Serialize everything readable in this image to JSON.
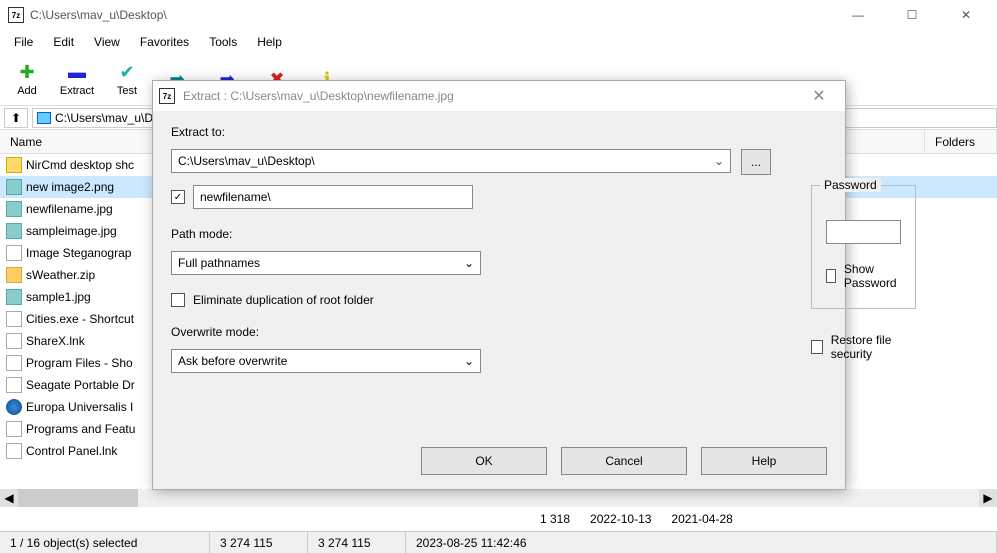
{
  "window": {
    "title": "C:\\Users\\mav_u\\Desktop\\",
    "appicon": "7z"
  },
  "menu": [
    "File",
    "Edit",
    "View",
    "Favorites",
    "Tools",
    "Help"
  ],
  "toolbar": {
    "add": "Add",
    "extract": "Extract",
    "test": "Test"
  },
  "address": "C:\\Users\\mav_u\\Desktop\\",
  "headers": {
    "name": "Name",
    "folders": "Folders"
  },
  "files": [
    {
      "name": "NirCmd desktop shc",
      "icon": "folder"
    },
    {
      "name": "new image2.png",
      "icon": "img",
      "sel": true
    },
    {
      "name": "newfilename.jpg",
      "icon": "img"
    },
    {
      "name": "sampleimage.jpg",
      "icon": "img"
    },
    {
      "name": "Image Steganograp",
      "icon": "lnk"
    },
    {
      "name": "sWeather.zip",
      "icon": "zip"
    },
    {
      "name": "sample1.jpg",
      "icon": "img"
    },
    {
      "name": "Cities.exe - Shortcut",
      "icon": "lnk"
    },
    {
      "name": "ShareX.lnk",
      "icon": "lnk"
    },
    {
      "name": "Program Files - Sho",
      "icon": "lnk"
    },
    {
      "name": "Seagate Portable Dr",
      "icon": "lnk"
    },
    {
      "name": "Europa Universalis I",
      "icon": "globe"
    },
    {
      "name": "Programs and Featu",
      "icon": "lnk"
    },
    {
      "name": "Control Panel.lnk",
      "icon": "lnk"
    }
  ],
  "detail": {
    "size": "1 318",
    "date1": "2022-10-13",
    "date2": "2021-04-28"
  },
  "status": {
    "sel": "1 / 16 object(s) selected",
    "s1": "3 274 115",
    "s2": "3 274 115",
    "ts": "2023-08-25 11:42:46"
  },
  "dialog": {
    "title": "Extract : C:\\Users\\mav_u\\Desktop\\newfilename.jpg",
    "extract_to_lbl": "Extract to:",
    "extract_to_val": "C:\\Users\\mav_u\\Desktop\\",
    "browse": "...",
    "subfolder_checked": true,
    "subfolder_val": "newfilename\\",
    "path_mode_lbl": "Path mode:",
    "path_mode_val": "Full pathnames",
    "elim_lbl": "Eliminate duplication of root folder",
    "overwrite_lbl": "Overwrite mode:",
    "overwrite_val": "Ask before overwrite",
    "password_lbl": "Password",
    "showpw_lbl": "Show Password",
    "restore_lbl": "Restore file security",
    "ok": "OK",
    "cancel": "Cancel",
    "help": "Help"
  }
}
